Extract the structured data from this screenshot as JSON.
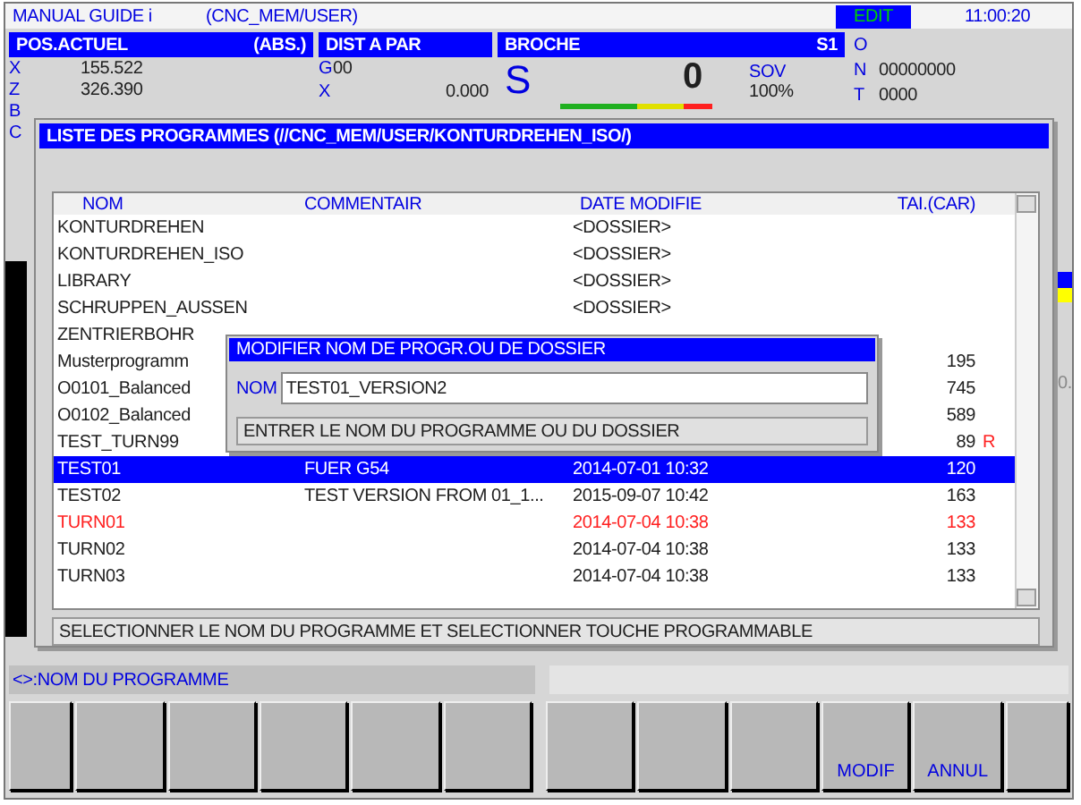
{
  "top_bar": {
    "title": "MANUAL GUIDE i",
    "path": "(CNC_MEM/USER)",
    "mode": "EDIT",
    "time": "11:00:20"
  },
  "position": {
    "title": "POS.ACTUEL",
    "mode": "(ABS.)",
    "axes": [
      {
        "axis": "X",
        "value": "155.522"
      },
      {
        "axis": "Z",
        "value": "326.390"
      },
      {
        "axis": "B"
      },
      {
        "axis": "C"
      }
    ]
  },
  "distance": {
    "title": "DIST A PAR",
    "g_code": "G",
    "g_value": "00",
    "axis": "X",
    "value": "0.000"
  },
  "spindle": {
    "title": "BROCHE",
    "channel": "S1",
    "letter": "S",
    "speed": "0",
    "override_label": "SOV",
    "override": "100%"
  },
  "info": [
    {
      "letter": "O"
    },
    {
      "letter": "N",
      "value": "00000000"
    },
    {
      "letter": "T",
      "value": "0000"
    }
  ],
  "side_text": "0.",
  "program_list": {
    "title": "LISTE DES PROGRAMMES (//CNC_MEM/USER/KONTURDREHEN_ISO/)",
    "columns": [
      "NOM",
      "COMMENTAIR",
      "DATE MODIFIE",
      "TAI.(CAR)"
    ],
    "rows": [
      {
        "name": "KONTURDREHEN",
        "date": "<DOSSIER>",
        "selected": false,
        "color": "#202020"
      },
      {
        "name": "KONTURDREHEN_ISO",
        "date": "<DOSSIER>",
        "selected": false,
        "color": "#202020"
      },
      {
        "name": "LIBRARY",
        "date": "<DOSSIER>",
        "selected": false,
        "color": "#202020"
      },
      {
        "name": "SCHRUPPEN_AUSSEN",
        "date": "<DOSSIER>",
        "selected": false,
        "color": "#202020"
      },
      {
        "name": "ZENTRIERBOHR",
        "selected": false,
        "color": "#202020"
      },
      {
        "name": "Musterprogramm",
        "size": "195",
        "selected": false,
        "color": "#202020"
      },
      {
        "name": "O0101_Balanced",
        "size": "745",
        "selected": false,
        "color": "#202020"
      },
      {
        "name": "O0102_Balanced",
        "size": "589",
        "selected": false,
        "color": "#202020"
      },
      {
        "name": "TEST_TURN99",
        "size": "89",
        "flag": "R",
        "selected": false,
        "color": "#202020"
      },
      {
        "name": "TEST01",
        "comment": "FUER G54",
        "date": "2014-07-01 10:32",
        "size": "120",
        "selected": true,
        "color": "#ffffff"
      },
      {
        "name": "TEST02",
        "comment": "TEST VERSION FROM 01_1...",
        "date": "2015-09-07 10:42",
        "size": "163",
        "selected": false,
        "color": "#202020"
      },
      {
        "name": "TURN01",
        "date": "2014-07-04 10:38",
        "size": "133",
        "selected": false,
        "color": "#ff2020"
      },
      {
        "name": "TURN02",
        "date": "2014-07-04 10:38",
        "size": "133",
        "selected": false,
        "color": "#202020"
      },
      {
        "name": "TURN03",
        "date": "2014-07-04 10:38",
        "size": "133",
        "selected": false,
        "color": "#202020"
      }
    ],
    "message": "SELECTIONNER LE NOM DU PROGRAMME ET SELECTIONNER TOUCHE PROGRAMMABLE"
  },
  "dialog": {
    "title": "MODIFIER NOM DE PROGR.OU DE DOSSIER",
    "label": "NOM",
    "value": "TEST01_VERSION2",
    "message": "ENTRER LE NOM DU PROGRAMME OU DU DOSSIER"
  },
  "input_line": {
    "prompt": "<>:NOM DU PROGRAMME"
  },
  "softkeys": [
    {
      "label": "MODIF"
    },
    {
      "label": "ANNUL"
    }
  ]
}
